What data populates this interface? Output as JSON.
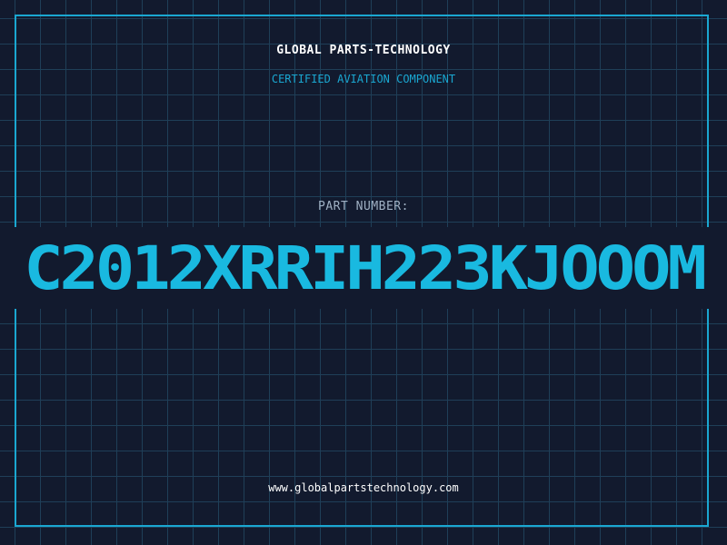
{
  "header": {
    "company": "GLOBAL PARTS-TECHNOLOGY",
    "subtitle": "CERTIFIED AVIATION COMPONENT"
  },
  "part": {
    "label": "PART NUMBER:",
    "value": "C2012XRRIH223KJOOOM"
  },
  "footer": {
    "url": "www.globalpartstechnology.com"
  },
  "colors": {
    "background": "#121a2e",
    "grid": "#1f3f58",
    "accent": "#1aa7d1",
    "part_number": "#19b9e0"
  }
}
